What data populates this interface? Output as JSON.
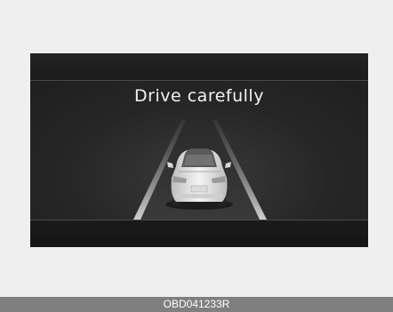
{
  "display": {
    "message": "Drive carefully",
    "icon": "car-rear-view-icon"
  },
  "caption": {
    "code": "OBD041233R"
  },
  "colors": {
    "page_background": "#efefef",
    "display_background": "#1f1f1f",
    "text": "#f2f2f2",
    "caption_bar": "#7f7f7f"
  }
}
